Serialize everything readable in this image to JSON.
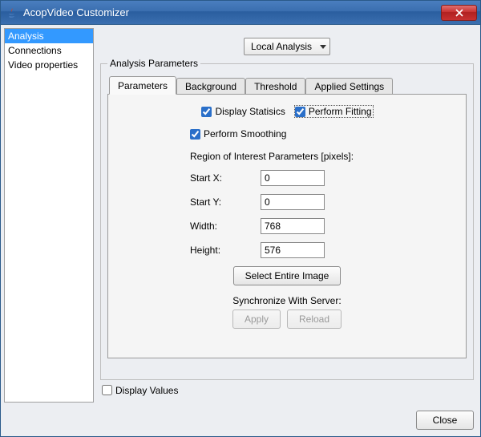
{
  "window": {
    "title": "AcopVideo Customizer"
  },
  "sidebar": {
    "items": [
      {
        "label": "Analysis",
        "selected": true
      },
      {
        "label": "Connections",
        "selected": false
      },
      {
        "label": "Video properties",
        "selected": false
      }
    ]
  },
  "analysis_mode": {
    "selected": "Local Analysis"
  },
  "fieldset": {
    "legend": "Analysis Parameters"
  },
  "tabs": [
    {
      "label": "Parameters",
      "active": true
    },
    {
      "label": "Background",
      "active": false
    },
    {
      "label": "Threshold",
      "active": false
    },
    {
      "label": "Applied Settings",
      "active": false
    }
  ],
  "checks": {
    "display_statistics": {
      "label": "Display Statisics",
      "checked": true
    },
    "perform_fitting": {
      "label": "Perform Fitting",
      "checked": true,
      "focused": true
    },
    "perform_smoothing": {
      "label": "Perform Smoothing",
      "checked": true
    }
  },
  "roi": {
    "header": "Region of Interest Parameters [pixels]:",
    "start_x": {
      "label": "Start X:",
      "value": "0"
    },
    "start_y": {
      "label": "Start Y:",
      "value": "0"
    },
    "width": {
      "label": "Width:",
      "value": "768"
    },
    "height": {
      "label": "Height:",
      "value": "576"
    }
  },
  "buttons": {
    "select_entire_image": "Select Entire Image",
    "sync_label": "Synchronize With Server:",
    "apply": "Apply",
    "reload": "Reload",
    "close": "Close"
  },
  "display_values": {
    "label": "Display Values",
    "checked": false
  }
}
